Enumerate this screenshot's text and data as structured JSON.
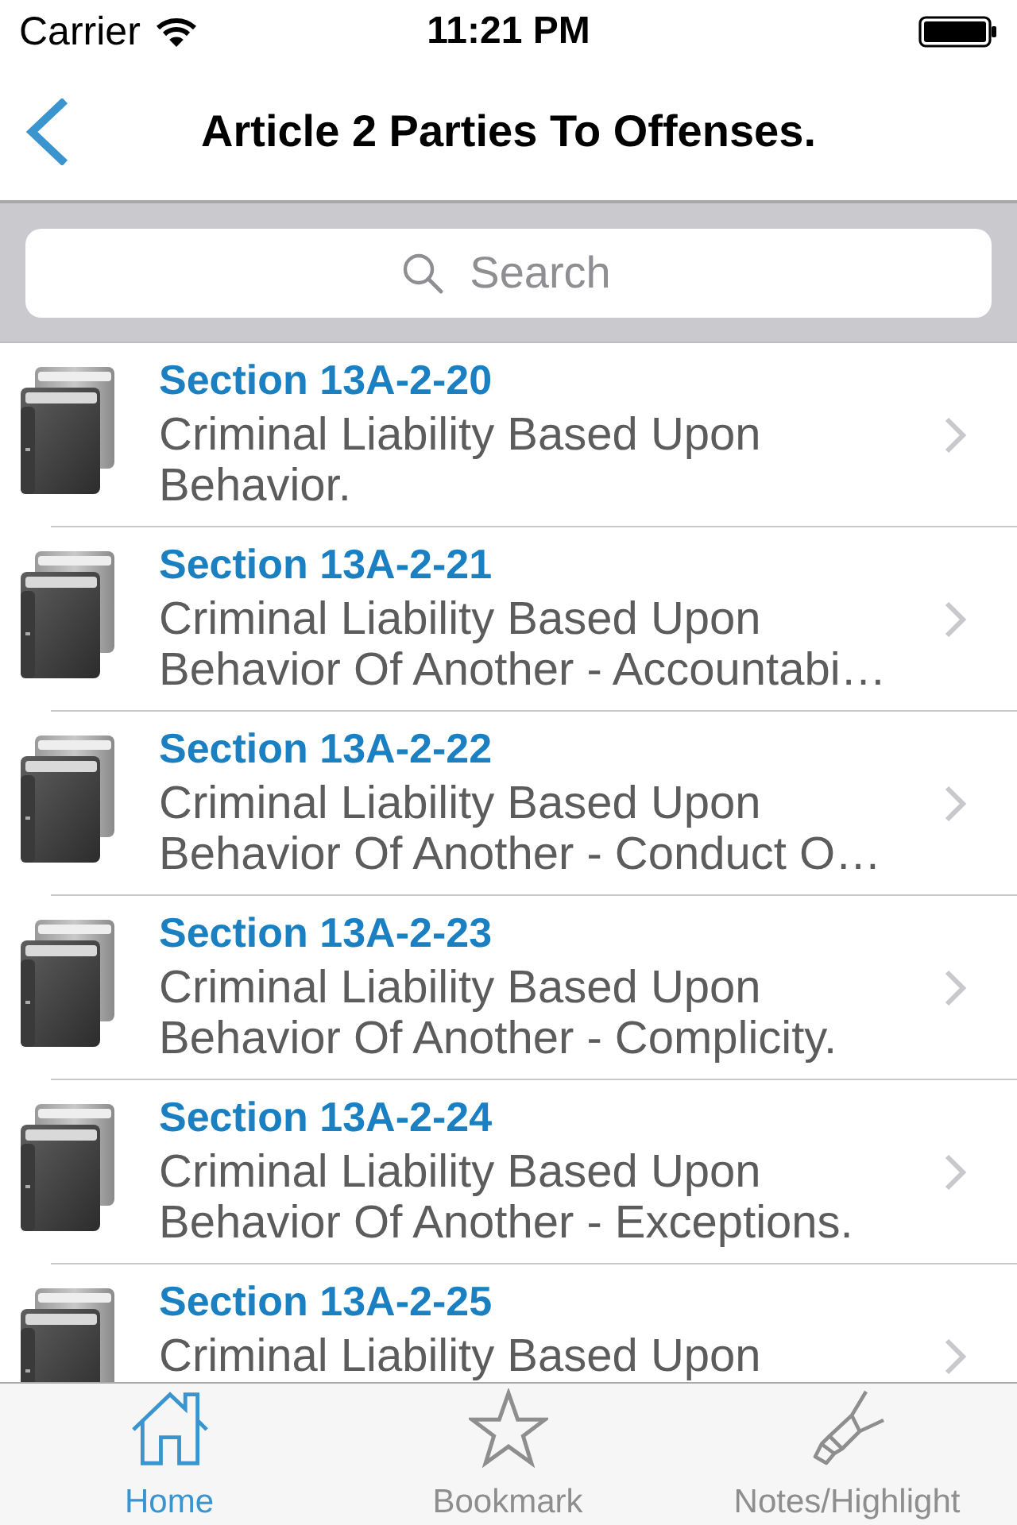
{
  "status_bar": {
    "carrier": "Carrier",
    "time": "11:21 PM"
  },
  "nav_bar": {
    "title": "Article 2 Parties To Offenses."
  },
  "search": {
    "placeholder": "Search"
  },
  "sections": [
    {
      "title": "Section 13A-2-20",
      "description": "Criminal Liability Based Upon Behavior."
    },
    {
      "title": "Section 13A-2-21",
      "description": "Criminal Liability Based Upon Behavior Of Another - Accountabi…"
    },
    {
      "title": "Section 13A-2-22",
      "description": "Criminal Liability Based Upon Behavior Of Another - Conduct O…"
    },
    {
      "title": "Section 13A-2-23",
      "description": "Criminal Liability Based Upon Behavior Of Another - Complicity."
    },
    {
      "title": "Section 13A-2-24",
      "description": "Criminal Liability Based Upon Behavior Of Another - Exceptions."
    },
    {
      "title": "Section 13A-2-25",
      "description": "Criminal Liability Based Upon"
    }
  ],
  "tab_bar": {
    "tabs": [
      {
        "label": "Home",
        "selected": true
      },
      {
        "label": "Bookmark",
        "selected": false
      },
      {
        "label": "Notes/Highlight",
        "selected": false
      }
    ]
  }
}
